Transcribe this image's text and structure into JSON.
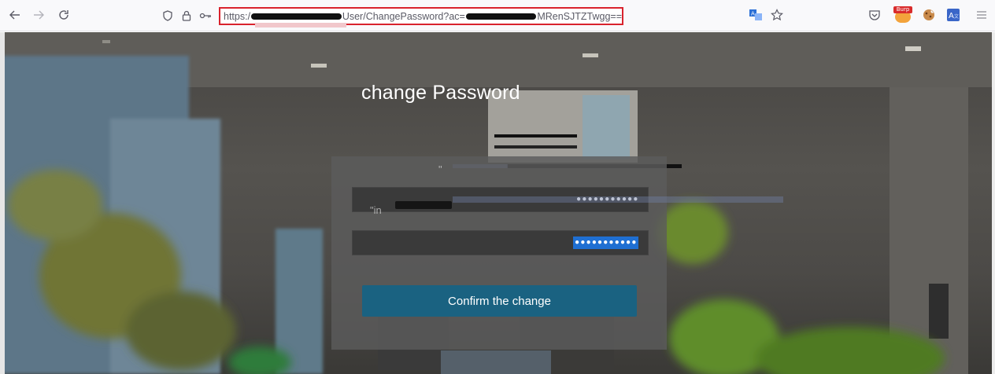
{
  "browser": {
    "back_icon": "arrow-left-icon",
    "forward_icon": "arrow-right-icon",
    "reload_icon": "reload-icon",
    "url": {
      "prefix": "https:/",
      "path": "User/ChangePassword?ac=",
      "suffix": "MRenSJTZTwgg=="
    },
    "extensions": [
      "translate-icon",
      "bookmark-star-icon",
      "pocket-icon",
      "burp-icon",
      "cookie-icon",
      "translate-extension-icon",
      "menu-icon"
    ],
    "burp_label": "Burp"
  },
  "page": {
    "title": "change Password",
    "password_field_1": {
      "value": "•••••••••••"
    },
    "password_field_2": {
      "value": "•••••••••••"
    },
    "confirm_button": "Confirm the change",
    "overlay_text_1": "\"in",
    "overlay_text_2": "\""
  },
  "colors": {
    "highlight_border": "#d9232d",
    "button_bg": "#1a6281",
    "selection": "#1f6fd2"
  }
}
